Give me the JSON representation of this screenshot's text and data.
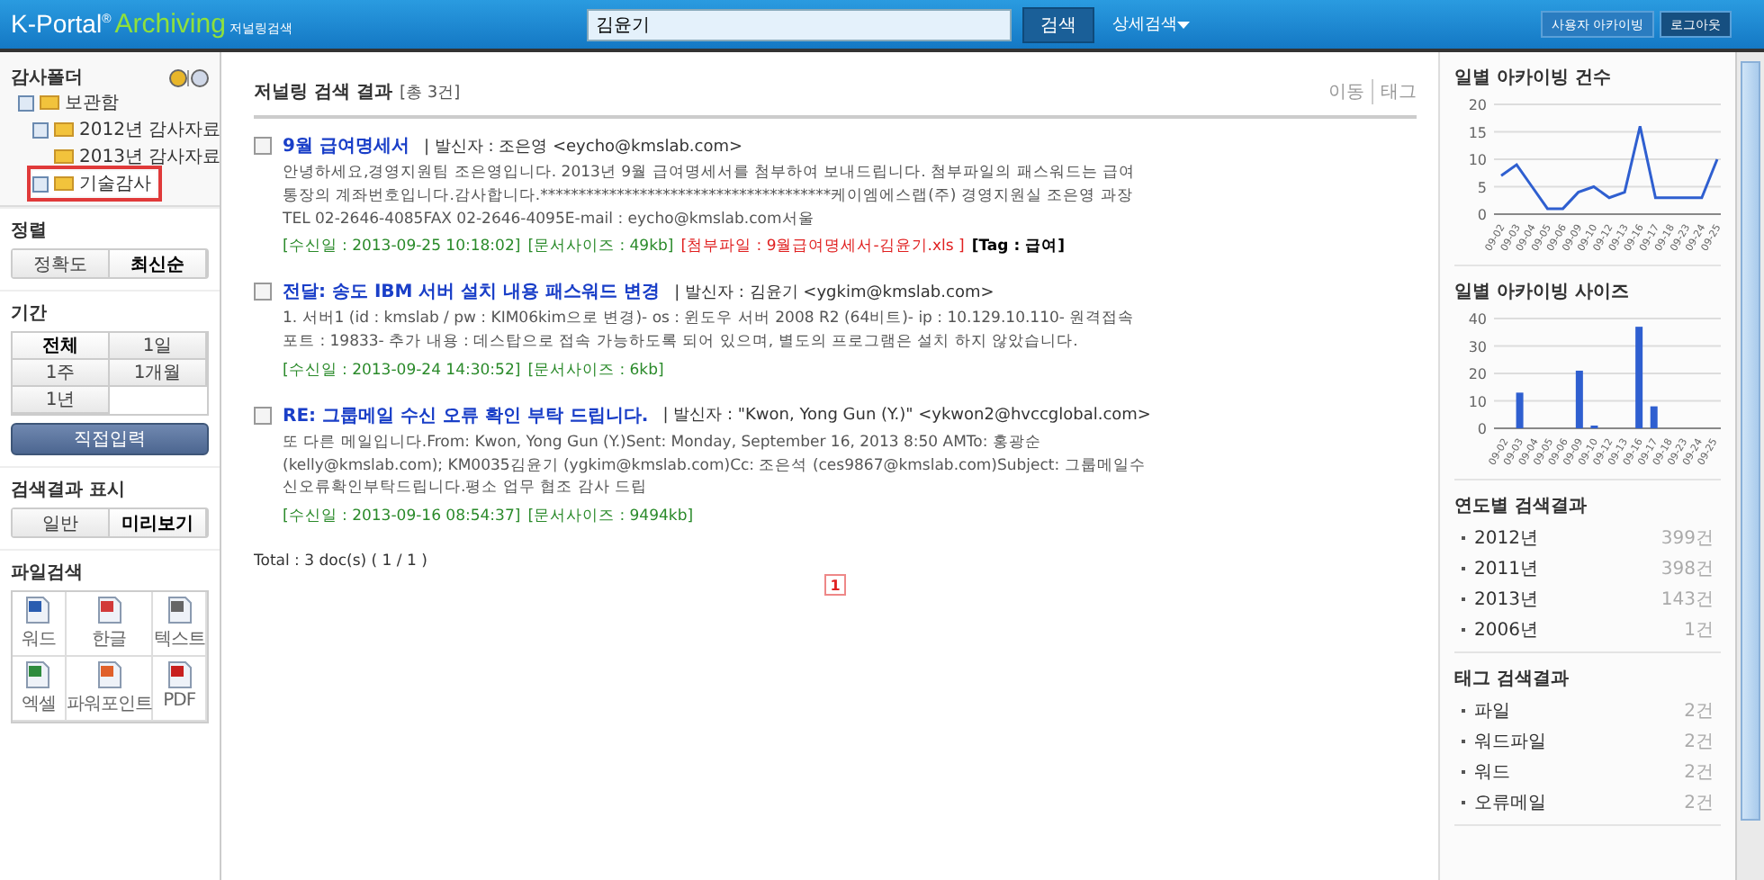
{
  "header": {
    "brand": "K-Portal",
    "brand_mark": "®",
    "product": "Archiving",
    "subtitle": "저널링검색",
    "search_value": "김윤기",
    "search_button": "검색",
    "advanced": "상세검색",
    "buttons": [
      "사용자 아카이빙",
      "로그아웃"
    ]
  },
  "sidebar": {
    "folder_title": "감사폴더",
    "tree": [
      {
        "label": "보관함",
        "expandable": true,
        "selected": false,
        "children": [
          {
            "label": "2012년 감사자료",
            "expandable": true,
            "selected": false
          },
          {
            "label": "2013년 감사자료",
            "expandable": false,
            "selected": false
          },
          {
            "label": "기술감사",
            "expandable": true,
            "selected": true
          }
        ]
      }
    ],
    "sort": {
      "title": "정렬",
      "options": [
        {
          "label": "정확도",
          "selected": false
        },
        {
          "label": "최신순",
          "selected": true
        }
      ]
    },
    "period": {
      "title": "기간",
      "options": [
        {
          "label": "전체",
          "selected": true
        },
        {
          "label": "1일",
          "selected": false
        },
        {
          "label": "1주",
          "selected": false
        },
        {
          "label": "1개월",
          "selected": false
        },
        {
          "label": "1년",
          "selected": false
        }
      ],
      "custom_button": "직접입력"
    },
    "display": {
      "title": "검색결과 표시",
      "options": [
        {
          "label": "일반",
          "selected": false
        },
        {
          "label": "미리보기",
          "selected": true
        }
      ]
    },
    "files": {
      "title": "파일검색",
      "types": [
        {
          "label": "워드",
          "kind": "word"
        },
        {
          "label": "한글",
          "kind": "hwp"
        },
        {
          "label": "텍스트",
          "kind": "text"
        },
        {
          "label": "엑셀",
          "kind": "excel"
        },
        {
          "label": "파워포인트",
          "kind": "ppt"
        },
        {
          "label": "PDF",
          "kind": "pdf"
        }
      ]
    }
  },
  "results": {
    "title": "저널링 검색 결과",
    "count": "[총 3건]",
    "actions": [
      "이동",
      "태그"
    ],
    "items": [
      {
        "checked": false,
        "title": "9월 급여명세서",
        "sender": "| 발신자 : 조은영 <eycho@kmslab.com>",
        "body": "안녕하세요,경영지원팀 조은영입니다. 2013년 9월 급여명세서를 첨부하여 보내드립니다. 첨부파일의 패스워드는 급여통장의 계좌번호입니다.감사합니다.**************************************케이엠에스랩(주) 경영지원실 조은영 과장TEL 02-2646-4085FAX 02-2646-4095E-mail : eycho@kmslab.com서울",
        "meta": [
          {
            "kind": "info",
            "text": "[수신일 : 2013-09-25 10:18:02]"
          },
          {
            "kind": "info",
            "text": "[문서사이즈 : 49kb]"
          },
          {
            "kind": "attachment",
            "text": "[첨부파일 : 9월급여명세서-김윤기.xls ]"
          },
          {
            "kind": "tag",
            "text": "[Tag : 급여]"
          }
        ]
      },
      {
        "checked": false,
        "title": "전달: 송도 IBM 서버 설치 내용 패스워드 변경",
        "sender": "| 발신자 : 김윤기 <ygkim@kmslab.com>",
        "body": "1. 서버1 (id : kmslab / pw : KIM06kim으로 변경)- os : 윈도우 서버 2008 R2 (64비트)- ip : 10.129.10.110- 원격접속포트 : 19833- 추가 내용 : 데스탑으로 접속 가능하도록 되어 있으며, 별도의 프로그램은 설치 하지 않았습니다.",
        "meta": [
          {
            "kind": "info",
            "text": "[수신일 : 2013-09-24 14:30:52]"
          },
          {
            "kind": "info",
            "text": "[문서사이즈 : 6kb]"
          }
        ]
      },
      {
        "checked": false,
        "title": "RE: 그룹메일 수신 오류 확인 부탁 드립니다.",
        "sender": "| 발신자 : \"Kwon, Yong Gun (Y.)\" <ykwon2@hvccglobal.com>",
        "body": "또 다른 메일입니다.From: Kwon, Yong Gun (Y.)Sent: Monday, September 16, 2013 8:50 AMTo: 홍광순 (kelly@kmslab.com); KM0035김윤기 (ygkim@kmslab.com)Cc: 조은석 (ces9867@kmslab.com)Subject: 그룹메일수신오류확인부탁드립니다.평소 업무 협조 감사 드립",
        "meta": [
          {
            "kind": "info",
            "text": "[수신일 : 2013-09-16 08:54:37]"
          },
          {
            "kind": "info",
            "text": "[문서사이즈 : 9494kb]"
          }
        ]
      }
    ],
    "total": "Total : 3 doc(s) ( 1 / 1 )",
    "pages": [
      {
        "label": "1",
        "selected": true
      }
    ]
  },
  "right": {
    "count_chart": {
      "title": "일별 아카이빙 건수",
      "chart_data": {
        "type": "line",
        "categories": [
          "09-02",
          "09-03",
          "09-04",
          "09-05",
          "09-06",
          "09-09",
          "09-10",
          "09-12",
          "09-13",
          "09-16",
          "09-17",
          "09-18",
          "09-23",
          "09-24",
          "09-25"
        ],
        "series": [
          {
            "color": "#2f5fd0",
            "values": [
              7,
              9,
              5,
              1,
              1,
              4,
              5,
              3,
              4,
              16,
              3,
              3,
              3,
              3,
              10
            ]
          }
        ],
        "ylim": [
          0,
          20
        ],
        "yticks": [
          0,
          5,
          10,
          15,
          20
        ],
        "grid": true
      }
    },
    "size_chart": {
      "title": "일별 아카이빙 사이즈",
      "chart_data": {
        "type": "bar",
        "categories": [
          "09-02",
          "09-03",
          "09-04",
          "09-05",
          "09-06",
          "09-09",
          "09-10",
          "09-12",
          "09-13",
          "09-16",
          "09-17",
          "09-18",
          "09-23",
          "09-24",
          "09-25"
        ],
        "series": [
          {
            "color": "#2f5fd0",
            "values": [
              0,
              13,
              0,
              0,
              0,
              21,
              1,
              0,
              0,
              37,
              8,
              0,
              0,
              0,
              0
            ]
          }
        ],
        "ylim": [
          0,
          40
        ],
        "yticks": [
          0,
          10,
          20,
          30,
          40
        ],
        "grid": true
      }
    },
    "year_results": {
      "title": "연도별 검색결과",
      "items": [
        {
          "label": "2012년",
          "count": "399건"
        },
        {
          "label": "2011년",
          "count": "398건"
        },
        {
          "label": "2013년",
          "count": "143건"
        },
        {
          "label": "2006년",
          "count": "1건"
        }
      ]
    },
    "tag_results": {
      "title": "태그 검색결과",
      "items": [
        {
          "label": "파일",
          "count": "2건"
        },
        {
          "label": "워드파일",
          "count": "2건"
        },
        {
          "label": "워드",
          "count": "2건"
        },
        {
          "label": "오류메일",
          "count": "2건"
        }
      ]
    }
  }
}
